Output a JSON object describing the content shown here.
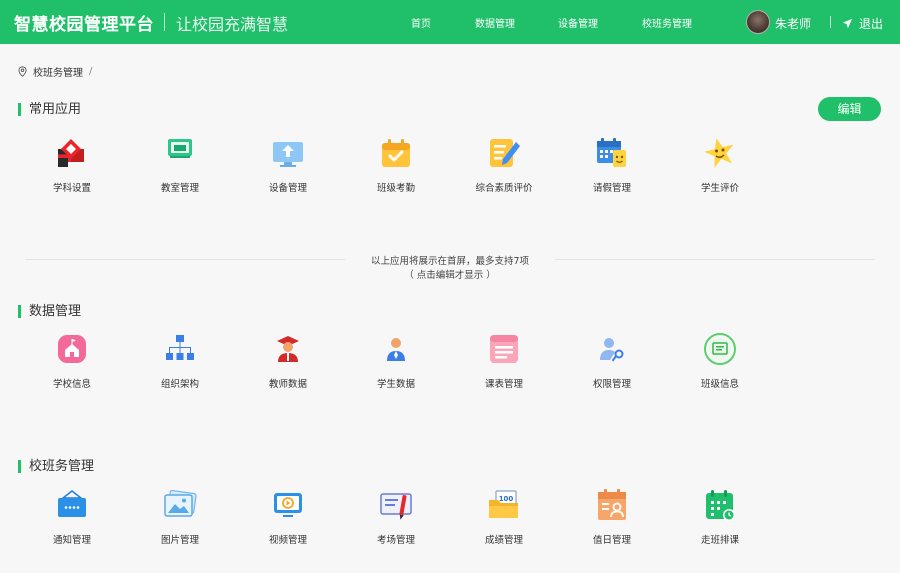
{
  "header": {
    "brand": "智慧校园管理平台",
    "slogan": "让校园充满智慧",
    "nav": [
      "首页",
      "数据管理",
      "设备管理",
      "校班务管理"
    ],
    "username": "朱老师",
    "logout": "退出",
    "accent_color": "#20c06a"
  },
  "breadcrumb": {
    "current": "校班务管理",
    "separator": "/"
  },
  "common": {
    "title": "常用应用",
    "edit_label": "编辑",
    "apps": [
      {
        "label": "学科设置",
        "icon": "subject-settings-icon"
      },
      {
        "label": "教室管理",
        "icon": "classroom-icon"
      },
      {
        "label": "设备管理",
        "icon": "device-icon"
      },
      {
        "label": "班级考勤",
        "icon": "attendance-icon"
      },
      {
        "label": "综合素质评价",
        "icon": "quality-eval-icon"
      },
      {
        "label": "请假管理",
        "icon": "leave-icon"
      },
      {
        "label": "学生评价",
        "icon": "student-eval-icon"
      }
    ],
    "hint_line1": "以上应用将展示在首屏，最多支持7项",
    "hint_line2": "（ 点击编辑才显示 ）"
  },
  "data_mgmt": {
    "title": "数据管理",
    "apps": [
      {
        "label": "学校信息",
        "icon": "school-info-icon"
      },
      {
        "label": "组织架构",
        "icon": "org-chart-icon"
      },
      {
        "label": "教师数据",
        "icon": "teacher-icon"
      },
      {
        "label": "学生数据",
        "icon": "student-icon"
      },
      {
        "label": "课表管理",
        "icon": "timetable-icon"
      },
      {
        "label": "权限管理",
        "icon": "permission-icon"
      },
      {
        "label": "班级信息",
        "icon": "class-info-icon"
      }
    ]
  },
  "class_affairs": {
    "title": "校班务管理",
    "apps": [
      {
        "label": "通知管理",
        "icon": "notice-icon"
      },
      {
        "label": "图片管理",
        "icon": "picture-icon"
      },
      {
        "label": "视频管理",
        "icon": "video-icon"
      },
      {
        "label": "考场管理",
        "icon": "exam-room-icon"
      },
      {
        "label": "成绩管理",
        "icon": "score-icon",
        "badge": "100"
      },
      {
        "label": "值日管理",
        "icon": "duty-icon"
      },
      {
        "label": "走班排课",
        "icon": "course-schedule-icon"
      }
    ]
  }
}
